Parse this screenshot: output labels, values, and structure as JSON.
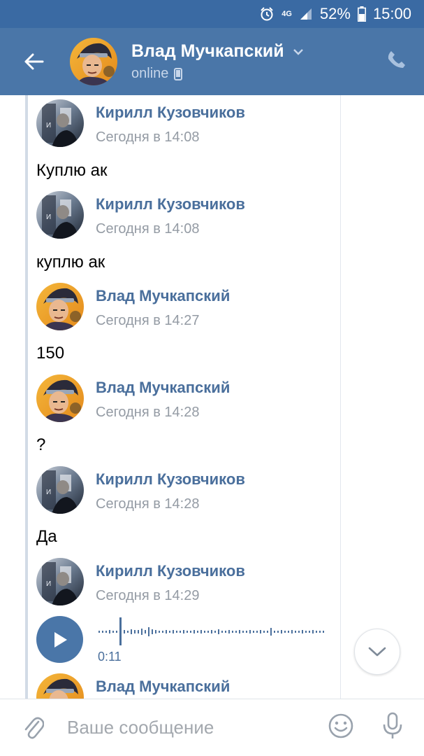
{
  "status_bar": {
    "network": "4G",
    "battery": "52%",
    "time": "15:00"
  },
  "header": {
    "contact_name": "Влад Мучкапский",
    "status": "online"
  },
  "messages": [
    {
      "author": "Кирилл Кузовчиков",
      "time": "Сегодня в 14:08",
      "text": "Куплю ак"
    },
    {
      "author": "Кирилл Кузовчиков",
      "time": "Сегодня в 14:08",
      "text": "куплю ак"
    },
    {
      "author": "Влад Мучкапский",
      "time": "Сегодня в 14:27",
      "text": "150"
    },
    {
      "author": "Влад Мучкапский",
      "time": "Сегодня в 14:28",
      "text": "?"
    },
    {
      "author": "Кирилл Кузовчиков",
      "time": "Сегодня в 14:28",
      "text": "Да"
    },
    {
      "author": "Кирилл Кузовчиков",
      "time": "Сегодня в 14:29",
      "voice_duration": "0:11"
    },
    {
      "author": "Влад Мучкапский"
    }
  ],
  "composer": {
    "placeholder": "Ваше сообщение"
  },
  "colors": {
    "header": "#4a76a8",
    "status_bar": "#3a6aa3",
    "name_link": "#4a6f9c",
    "play_button": "#4a76a8"
  },
  "icons": {
    "back": "arrow-left-icon",
    "chevron": "chevron-down-icon",
    "mobile": "phone-device-icon",
    "call": "phone-icon",
    "play": "play-icon",
    "scroll": "chevron-down-icon",
    "attach": "paperclip-icon",
    "emoji": "smile-icon",
    "mic": "microphone-icon"
  }
}
